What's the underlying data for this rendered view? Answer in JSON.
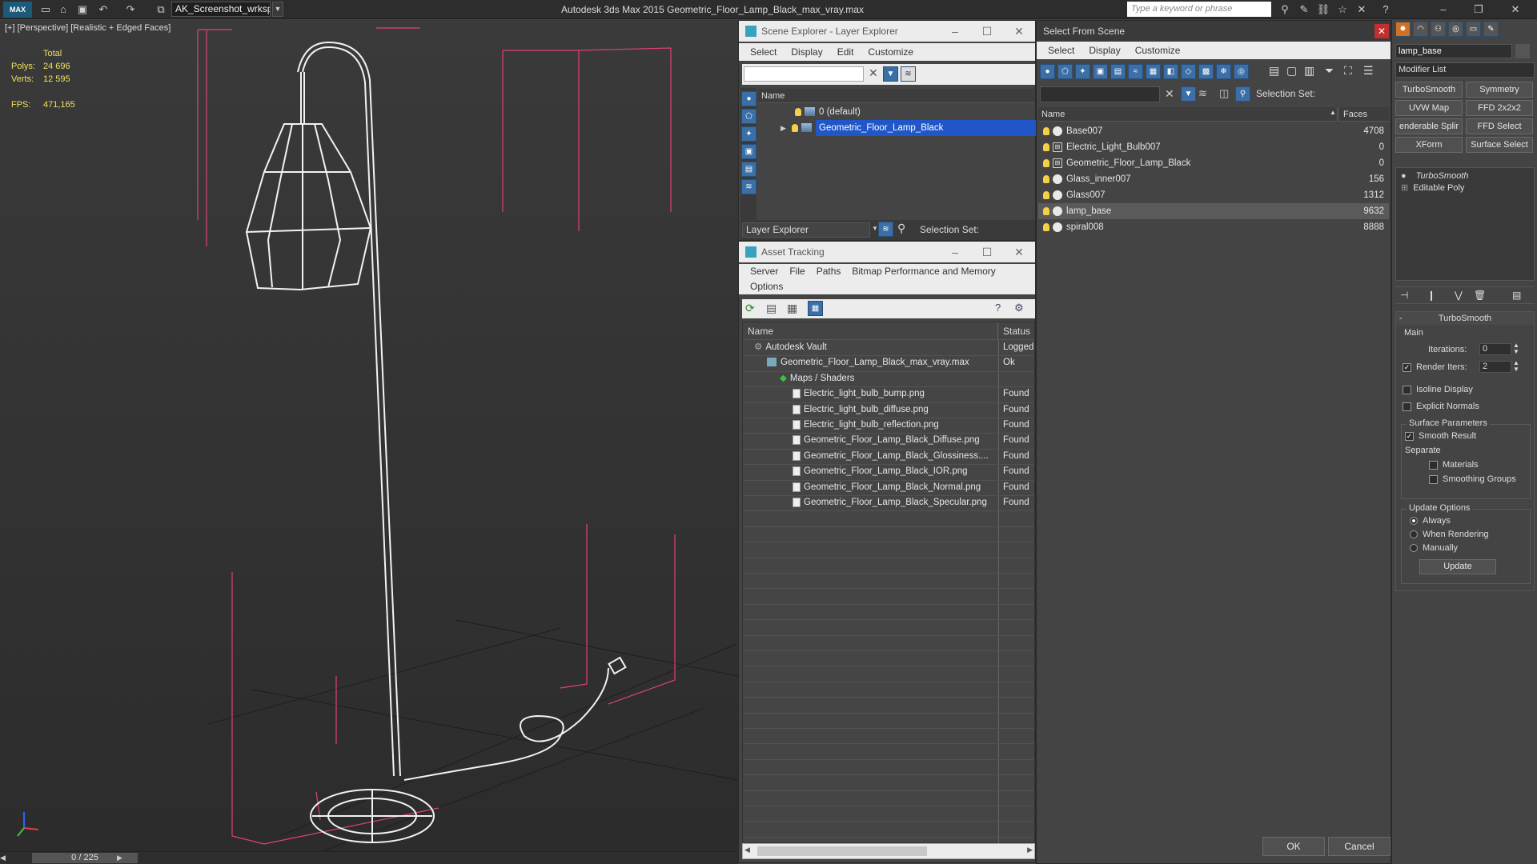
{
  "app": {
    "logo": "MAX",
    "workspace": "AK_Screenshot_wrksp",
    "title": "Autodesk 3ds Max  2015    Geometric_Floor_Lamp_Black_max_vray.max",
    "search_placeholder": "Type a keyword or phrase"
  },
  "viewport": {
    "label": "[+] [Perspective] [Realistic + Edged Faces]",
    "stats": {
      "total_label": "Total",
      "polys_label": "Polys:",
      "polys": "24 696",
      "verts_label": "Verts:",
      "verts": "12 595",
      "fps_label": "FPS:",
      "fps": "471,165"
    },
    "timeline": "0 / 225"
  },
  "scene_explorer": {
    "title": "Scene Explorer - Layer Explorer",
    "menu": [
      "Select",
      "Display",
      "Edit",
      "Customize"
    ],
    "column": "Name",
    "layers": [
      {
        "name": "0 (default)",
        "selected": false
      },
      {
        "name": "Geometric_Floor_Lamp_Black",
        "selected": true
      }
    ],
    "footer_dropdown": "Layer Explorer",
    "selection_set_label": "Selection Set:"
  },
  "asset_tracking": {
    "title": "Asset Tracking",
    "menu_row1": [
      "Server",
      "File",
      "Paths",
      "Bitmap Performance and Memory"
    ],
    "menu_row2": [
      "Options"
    ],
    "col_name": "Name",
    "col_status": "Status",
    "rows": [
      {
        "name": "Autodesk Vault",
        "status": "Logged",
        "indent": 1,
        "kind": "vault"
      },
      {
        "name": "Geometric_Floor_Lamp_Black_max_vray.max",
        "status": "Ok",
        "indent": 2,
        "kind": "max"
      },
      {
        "name": "Maps / Shaders",
        "status": "",
        "indent": 3,
        "kind": "folder"
      },
      {
        "name": "Electric_light_bulb_bump.png",
        "status": "Found",
        "indent": 4,
        "kind": "file"
      },
      {
        "name": "Electric_light_bulb_diffuse.png",
        "status": "Found",
        "indent": 4,
        "kind": "file"
      },
      {
        "name": "Electric_light_bulb_reflection.png",
        "status": "Found",
        "indent": 4,
        "kind": "file"
      },
      {
        "name": "Geometric_Floor_Lamp_Black_Diffuse.png",
        "status": "Found",
        "indent": 4,
        "kind": "file"
      },
      {
        "name": "Geometric_Floor_Lamp_Black_Glossiness....",
        "status": "Found",
        "indent": 4,
        "kind": "file"
      },
      {
        "name": "Geometric_Floor_Lamp_Black_IOR.png",
        "status": "Found",
        "indent": 4,
        "kind": "file"
      },
      {
        "name": "Geometric_Floor_Lamp_Black_Normal.png",
        "status": "Found",
        "indent": 4,
        "kind": "file"
      },
      {
        "name": "Geometric_Floor_Lamp_Black_Specular.png",
        "status": "Found",
        "indent": 4,
        "kind": "file"
      }
    ]
  },
  "select_from_scene": {
    "title": "Select From Scene",
    "menu": [
      "Select",
      "Display",
      "Customize"
    ],
    "selection_set_label": "Selection Set:",
    "col_name": "Name",
    "col_faces": "Faces",
    "objects": [
      {
        "name": "Base007",
        "faces": "4708",
        "selected": false,
        "icon": "sphere"
      },
      {
        "name": "Electric_Light_Bulb007",
        "faces": "0",
        "selected": false,
        "icon": "group"
      },
      {
        "name": "Geometric_Floor_Lamp_Black",
        "faces": "0",
        "selected": false,
        "icon": "group"
      },
      {
        "name": "Glass_inner007",
        "faces": "156",
        "selected": false,
        "icon": "sphere"
      },
      {
        "name": "Glass007",
        "faces": "1312",
        "selected": false,
        "icon": "sphere"
      },
      {
        "name": "lamp_base",
        "faces": "9632",
        "selected": true,
        "icon": "sphere"
      },
      {
        "name": "spiral008",
        "faces": "8888",
        "selected": false,
        "icon": "sphere"
      }
    ],
    "ok": "OK",
    "cancel": "Cancel"
  },
  "command_panel": {
    "object_name": "lamp_base",
    "modifier_list": "Modifier List",
    "modifier_buttons": [
      "TurboSmooth",
      "Symmetry",
      "UVW Map",
      "FFD 2x2x2",
      "enderable Splir",
      "FFD Select",
      "XForm",
      "Surface Select"
    ],
    "stack": [
      {
        "name": "TurboSmooth",
        "italic": true
      },
      {
        "name": "Editable Poly",
        "italic": false
      }
    ],
    "rollout_title": "TurboSmooth",
    "main_label": "Main",
    "iterations_label": "Iterations:",
    "iterations": "0",
    "render_iters_label": "Render Iters:",
    "render_iters": "2",
    "isoline_label": "Isoline Display",
    "explicit_normals_label": "Explicit Normals",
    "surface_params_label": "Surface Parameters",
    "smooth_result_label": "Smooth Result",
    "separate_label": "Separate",
    "materials_label": "Materials",
    "smoothing_groups_label": "Smoothing Groups",
    "update_options_label": "Update Options",
    "always_label": "Always",
    "when_rendering_label": "When Rendering",
    "manually_label": "Manually",
    "update_button": "Update"
  },
  "colors": {
    "accent": "#2e6fd8",
    "selection_blue": "#1f56c8",
    "stats_yellow": "#f0e060",
    "bbox_pink": "#e0407a"
  }
}
